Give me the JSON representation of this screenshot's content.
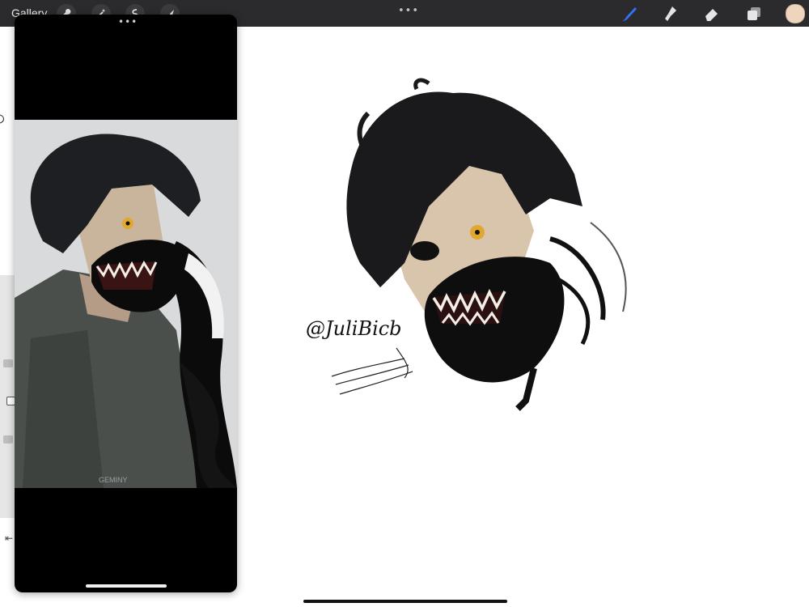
{
  "toolbar": {
    "gallery_label": "Gallery",
    "left_tools": [
      "wrench-icon",
      "magic-wand-icon",
      "selection-icon",
      "transform-arrow-icon"
    ],
    "center_menu": "•••",
    "right_tools": [
      "brush-icon",
      "smudge-icon",
      "eraser-icon",
      "layers-icon"
    ],
    "active_tool": "brush-icon",
    "accent_color": "#2f74f5",
    "current_color": "#efd5bd"
  },
  "reference_panel": {
    "menu_dots": "•••",
    "watermark": "GEMINY"
  },
  "canvas": {
    "signature": "@JuliBicb"
  },
  "sidebar": {
    "undo_icon": "undo-icon"
  }
}
